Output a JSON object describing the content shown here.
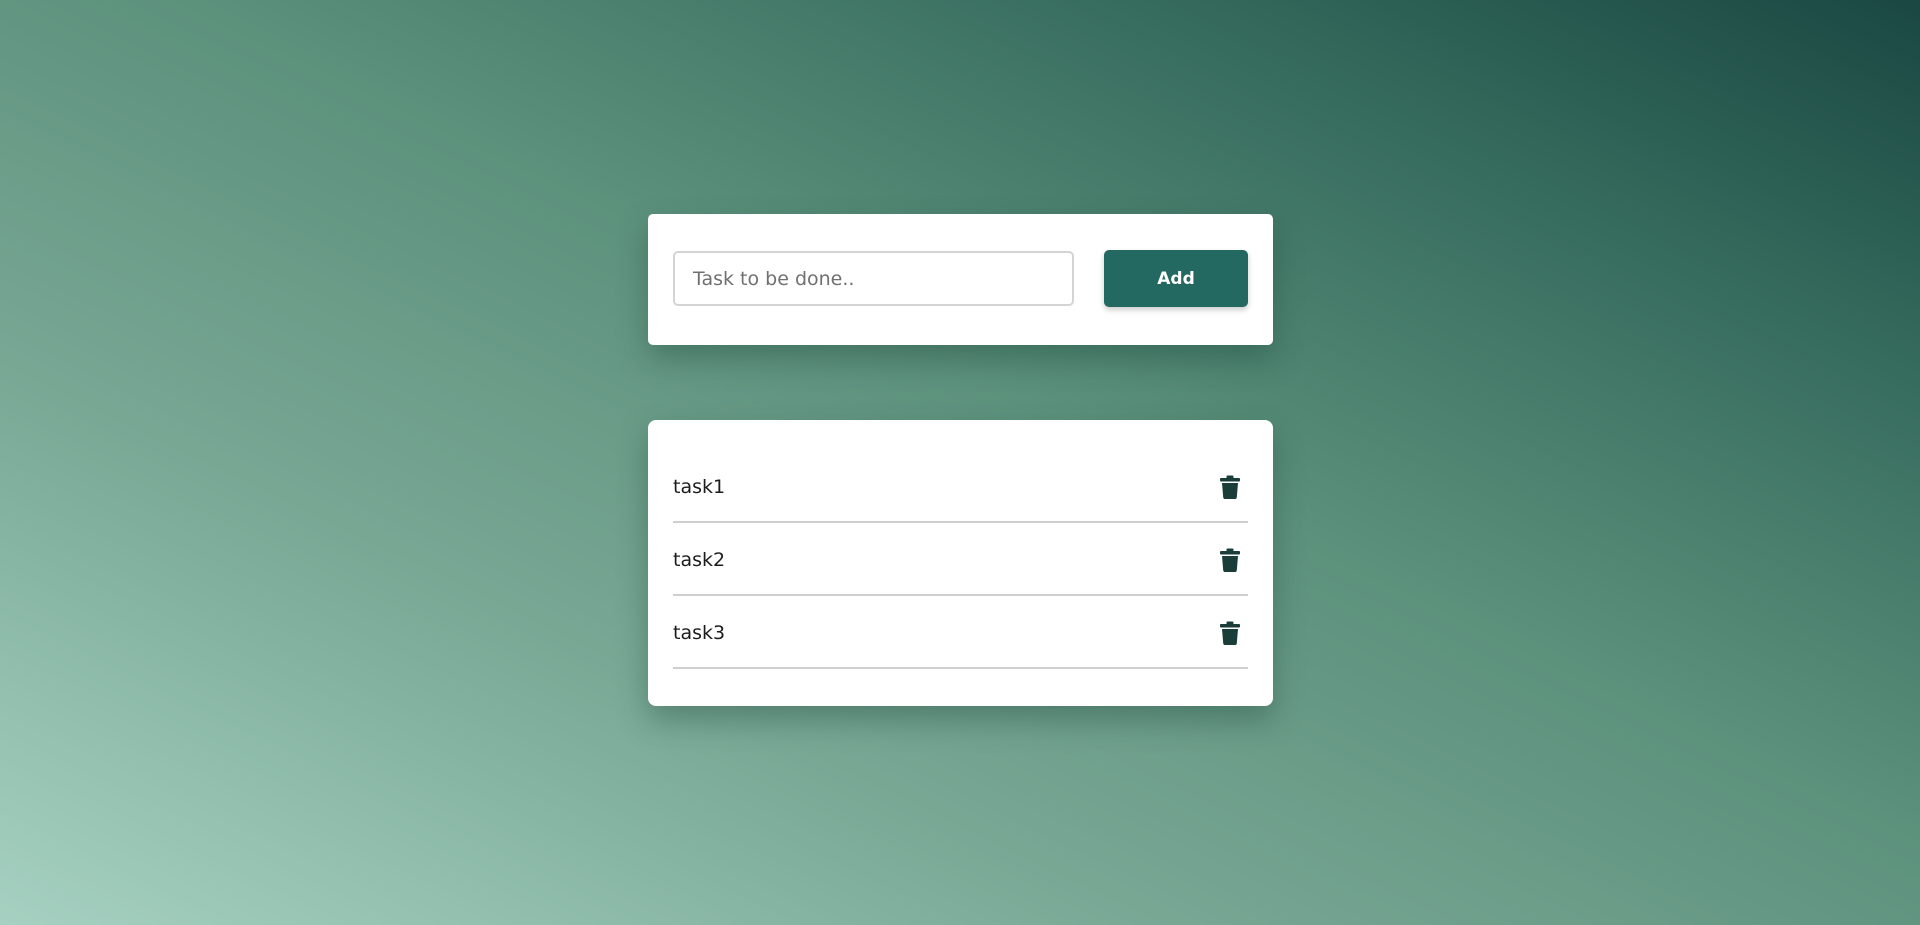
{
  "input_card": {
    "task_input": {
      "value": "",
      "placeholder": "Task to be done.."
    },
    "add_label": "Add"
  },
  "task_list": {
    "items": [
      {
        "label": "task1",
        "icon": "trash-icon"
      },
      {
        "label": "task2",
        "icon": "trash-icon"
      },
      {
        "label": "task3",
        "icon": "trash-icon"
      }
    ]
  },
  "colors": {
    "accent": "#246961",
    "icon": "#1a3d3a",
    "background_start": "#a6d1c2",
    "background_end": "#1a4742"
  }
}
